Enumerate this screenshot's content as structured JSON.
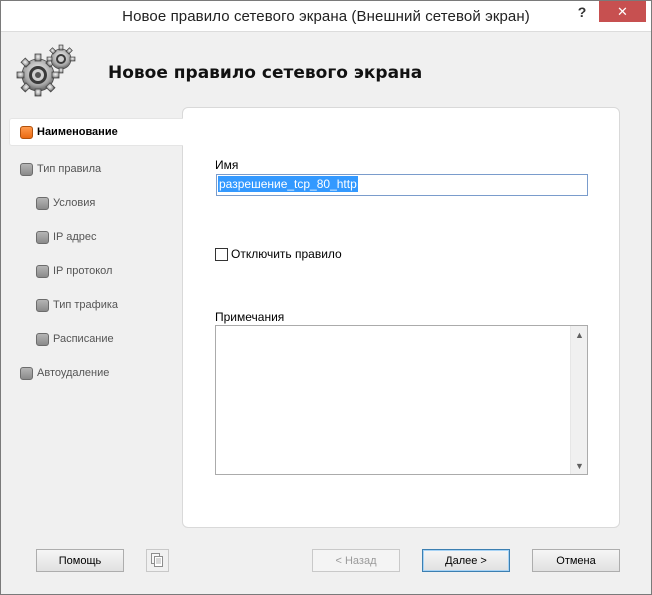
{
  "window": {
    "title": "Новое правило сетевого экрана (Внешний сетевой экран)",
    "help_label": "?",
    "close_label": "✕"
  },
  "header": {
    "title": "Новое правило сетевого экрана",
    "icon": "gears-icon"
  },
  "nav": {
    "items": [
      {
        "label": "Наименование",
        "active": true,
        "bullet": "orange"
      },
      {
        "label": "Тип правила",
        "active": false,
        "bullet": "gray"
      },
      {
        "label": "Условия",
        "active": false,
        "bullet": "gray"
      },
      {
        "label": "IP адрес",
        "active": false,
        "bullet": "gray"
      },
      {
        "label": "IP протокол",
        "active": false,
        "bullet": "gray"
      },
      {
        "label": "Тип трафика",
        "active": false,
        "bullet": "gray"
      },
      {
        "label": "Расписание",
        "active": false,
        "bullet": "gray"
      },
      {
        "label": "Автоудаление",
        "active": false,
        "bullet": "gray"
      }
    ]
  },
  "form": {
    "name_label": "Имя",
    "name_value": "разрешение_tcp_80_http",
    "disable_label": "Отключить правило",
    "disable_checked": false,
    "notes_label": "Примечания",
    "notes_value": ""
  },
  "footer": {
    "help_button": "Помощь",
    "back_button": "< Назад",
    "next_button": "Далее >",
    "cancel_button": "Отмена"
  },
  "colors": {
    "accent": "#3399ff",
    "active_bullet": "#ea6a12",
    "close_button": "#c75050"
  }
}
